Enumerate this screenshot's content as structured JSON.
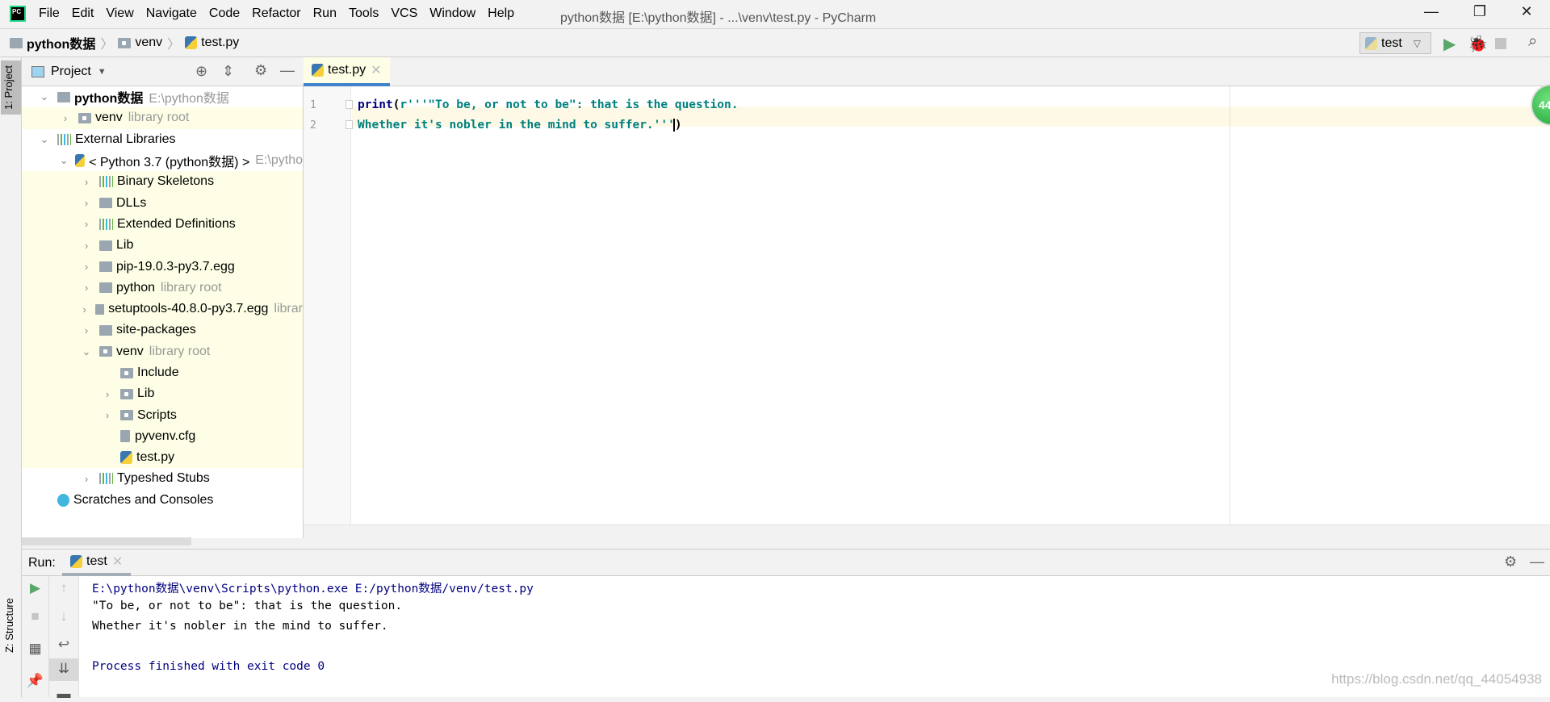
{
  "window": {
    "title": "python数据 [E:\\python数据] - ...\\venv\\test.py - PyCharm",
    "logo": "PC"
  },
  "menu": [
    "File",
    "Edit",
    "View",
    "Navigate",
    "Code",
    "Refactor",
    "Run",
    "Tools",
    "VCS",
    "Window",
    "Help"
  ],
  "breadcrumb": [
    "python数据",
    "venv",
    "test.py"
  ],
  "run_config": "test",
  "left_stripe": {
    "project": "1: Project",
    "structure": "Z: Structure"
  },
  "project_panel": {
    "title": "Project"
  },
  "tree": [
    {
      "label": "python数据",
      "hint": "E:\\python数据",
      "level": 0,
      "chev": "v",
      "icon": "folder",
      "bold": true,
      "hl": false
    },
    {
      "label": "venv",
      "hint": "library root",
      "level": 1,
      "chev": ">",
      "icon": "folder-dot",
      "hl": true
    },
    {
      "label": "External Libraries",
      "level": 0,
      "chev": "v",
      "icon": "library",
      "hl": false
    },
    {
      "label": "< Python 3.7 (python数据) >",
      "hint": "E:\\pytho",
      "level": 1,
      "chev": "v",
      "icon": "python",
      "hl": false
    },
    {
      "label": "Binary Skeletons",
      "level": 2,
      "chev": ">",
      "icon": "library",
      "hl": true
    },
    {
      "label": "DLLs",
      "level": 2,
      "chev": ">",
      "icon": "folder",
      "hl": true
    },
    {
      "label": "Extended Definitions",
      "level": 2,
      "chev": ">",
      "icon": "library",
      "hl": true
    },
    {
      "label": "Lib",
      "level": 2,
      "chev": ">",
      "icon": "folder",
      "hl": true
    },
    {
      "label": "pip-19.0.3-py3.7.egg",
      "level": 2,
      "chev": ">",
      "icon": "folder",
      "hl": true
    },
    {
      "label": "python",
      "hint": "library root",
      "level": 2,
      "chev": ">",
      "icon": "folder",
      "hl": true
    },
    {
      "label": "setuptools-40.8.0-py3.7.egg",
      "hint": "librar",
      "level": 2,
      "chev": ">",
      "icon": "folder",
      "hl": true
    },
    {
      "label": "site-packages",
      "level": 2,
      "chev": ">",
      "icon": "folder",
      "hl": true
    },
    {
      "label": "venv",
      "hint": "library root",
      "level": 2,
      "chev": "v",
      "icon": "folder-dot",
      "hl": true
    },
    {
      "label": "Include",
      "level": 3,
      "chev": "",
      "icon": "folder-dot",
      "hl": true
    },
    {
      "label": "Lib",
      "level": 3,
      "chev": ">",
      "icon": "folder-dot",
      "hl": true
    },
    {
      "label": "Scripts",
      "level": 3,
      "chev": ">",
      "icon": "folder-dot",
      "hl": true
    },
    {
      "label": "pyvenv.cfg",
      "level": 3,
      "chev": "",
      "icon": "file",
      "hl": true
    },
    {
      "label": "test.py",
      "level": 3,
      "chev": "",
      "icon": "python",
      "hl": true
    },
    {
      "label": "Typeshed Stubs",
      "level": 2,
      "chev": ">",
      "icon": "library",
      "hl": false
    },
    {
      "label": "Scratches and Consoles",
      "level": 0,
      "chev": "",
      "icon": "scratches",
      "hl": false
    }
  ],
  "editor": {
    "tab": "test.py",
    "lines": [
      {
        "num": "1",
        "func": "print",
        "open": "(",
        "str": "r'''\"To be, or not to be\": that is the question.",
        "close": ""
      },
      {
        "num": "2",
        "func": "",
        "open": "",
        "str": "Whether it's nobler in the mind to suffer.'''",
        "close": ")"
      }
    ],
    "badge": "44"
  },
  "run": {
    "label": "Run:",
    "tab": "test",
    "output": [
      {
        "text": "E:\\python数据\\venv\\Scripts\\python.exe E:/python数据/venv/test.py",
        "color": "#000080"
      },
      {
        "text": "\"To be, or not to be\": that is the question.",
        "color": "#000000"
      },
      {
        "text": "Whether it's nobler in the mind to suffer.",
        "color": "#000000"
      },
      {
        "text": "",
        "color": "#000000"
      },
      {
        "text": "Process finished with exit code 0",
        "color": "#000080"
      }
    ]
  },
  "watermark": "https://blog.csdn.net/qq_44054938",
  "colors": {
    "accent": "#4083c9",
    "run_green": "#59a869",
    "highlight": "#fefee6"
  }
}
